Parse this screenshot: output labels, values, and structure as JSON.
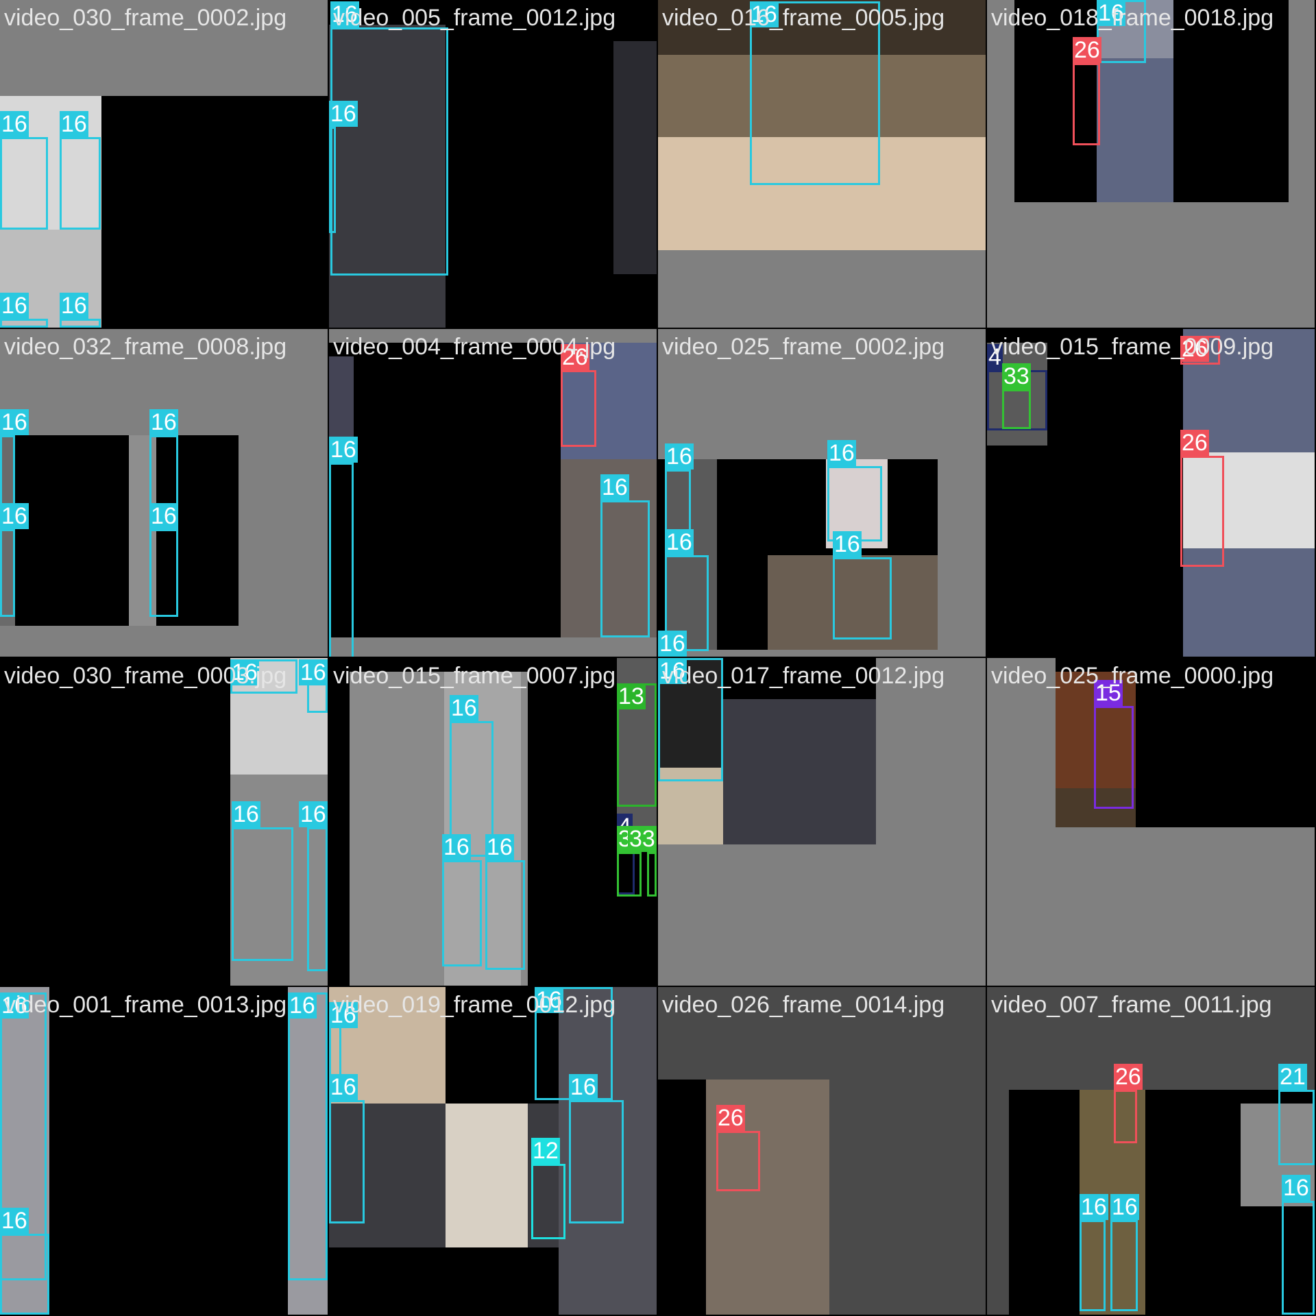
{
  "class_colors": {
    "4": "#1f2b6b",
    "12": "#1ee0e0",
    "13": "#2bb52b",
    "15": "#7a2be0",
    "16": "#29c9e0",
    "21": "#29c9e0",
    "26": "#f0505a",
    "33": "#33c233"
  },
  "tiles": [
    {
      "title": "video_030_frame_0002.jpg",
      "tags": [
        "16",
        "16",
        "16",
        "16"
      ]
    },
    {
      "title": "video_005_frame_0012.jpg",
      "tags": [
        "16",
        "16"
      ]
    },
    {
      "title": "video_016_frame_0005.jpg",
      "tags": [
        "16"
      ]
    },
    {
      "title": "video_018_frame_0018.jpg",
      "tags": [
        "16",
        "26"
      ]
    },
    {
      "title": "video_032_frame_0008.jpg",
      "tags": [
        "16",
        "16",
        "16",
        "16"
      ]
    },
    {
      "title": "video_004_frame_0004.jpg",
      "tags": [
        "26",
        "16",
        "16"
      ]
    },
    {
      "title": "video_025_frame_0002.jpg",
      "tags": [
        "16",
        "16",
        "16",
        "16",
        "16"
      ]
    },
    {
      "title": "video_015_frame_0009.jpg",
      "tags": [
        "4",
        "33",
        "26",
        "26"
      ]
    },
    {
      "title": "video_030_frame_0003.jpg",
      "tags": [
        "16",
        "16",
        "16",
        "16"
      ]
    },
    {
      "title": "video_015_frame_0007.jpg",
      "tags": [
        "13",
        "16",
        "4",
        "33",
        "33",
        "16",
        "16"
      ]
    },
    {
      "title": "video_017_frame_0012.jpg",
      "tags": [
        "16"
      ]
    },
    {
      "title": "video_025_frame_0000.jpg",
      "tags": [
        "15"
      ]
    },
    {
      "title": "video_001_frame_0013.jpg",
      "tags": [
        "16",
        "16",
        "16"
      ]
    },
    {
      "title": "video_019_frame_0012.jpg",
      "tags": [
        "16",
        "16",
        "16",
        "16",
        "12"
      ]
    },
    {
      "title": "video_026_frame_0014.jpg",
      "tags": [
        "26"
      ]
    },
    {
      "title": "video_007_frame_0011.jpg",
      "tags": [
        "26",
        "21",
        "16",
        "16",
        "16"
      ]
    }
  ]
}
